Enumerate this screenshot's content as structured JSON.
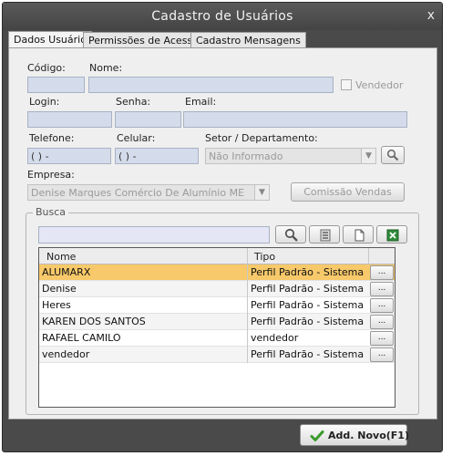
{
  "window": {
    "title": "Cadastro de Usuários",
    "close_label": "x"
  },
  "tabs": [
    {
      "label": "Dados Usuário"
    },
    {
      "label": "Permissões de Acesso"
    },
    {
      "label": "Cadastro Mensagens"
    }
  ],
  "form": {
    "codigo_label": "Código:",
    "nome_label": "Nome:",
    "vendedor_label": "Vendedor",
    "login_label": "Login:",
    "senha_label": "Senha:",
    "email_label": "Email:",
    "telefone_label": "Telefone:",
    "telefone_value": "(  )    -",
    "celular_label": "Celular:",
    "celular_value": "(  )    -",
    "setor_label": "Setor / Departamento:",
    "setor_value": "Não Informado",
    "empresa_label": "Empresa:",
    "empresa_value": "Denise Marques Comércio De Alumínio ME",
    "comissao_label": "Comissão Vendas"
  },
  "busca": {
    "label": "Busca",
    "grid": {
      "headers": [
        "Nome",
        "Tipo"
      ],
      "rows": [
        {
          "nome": "ALUMARX",
          "tipo": "Perfil Padrão - Sistema",
          "action": "..."
        },
        {
          "nome": "Denise",
          "tipo": "Perfil Padrão - Sistema",
          "action": "..."
        },
        {
          "nome": "Heres",
          "tipo": "Perfil Padrão - Sistema",
          "action": "..."
        },
        {
          "nome": "KAREN DOS SANTOS",
          "tipo": "Perfil Padrão - Sistema",
          "action": "..."
        },
        {
          "nome": "RAFAEL CAMILO",
          "tipo": "vendedor",
          "action": "..."
        },
        {
          "nome": "vendedor",
          "tipo": "Perfil Padrão - Sistema",
          "action": "..."
        }
      ]
    }
  },
  "footer": {
    "add_label": "Add. Novo(F1)"
  },
  "colors": {
    "selected_row": "#f7c96a",
    "field_bg": "#d4dceb",
    "window_bg": "#4a4a4a",
    "excel_green": "#2e8b3a",
    "check_green": "#3a9a2a"
  }
}
